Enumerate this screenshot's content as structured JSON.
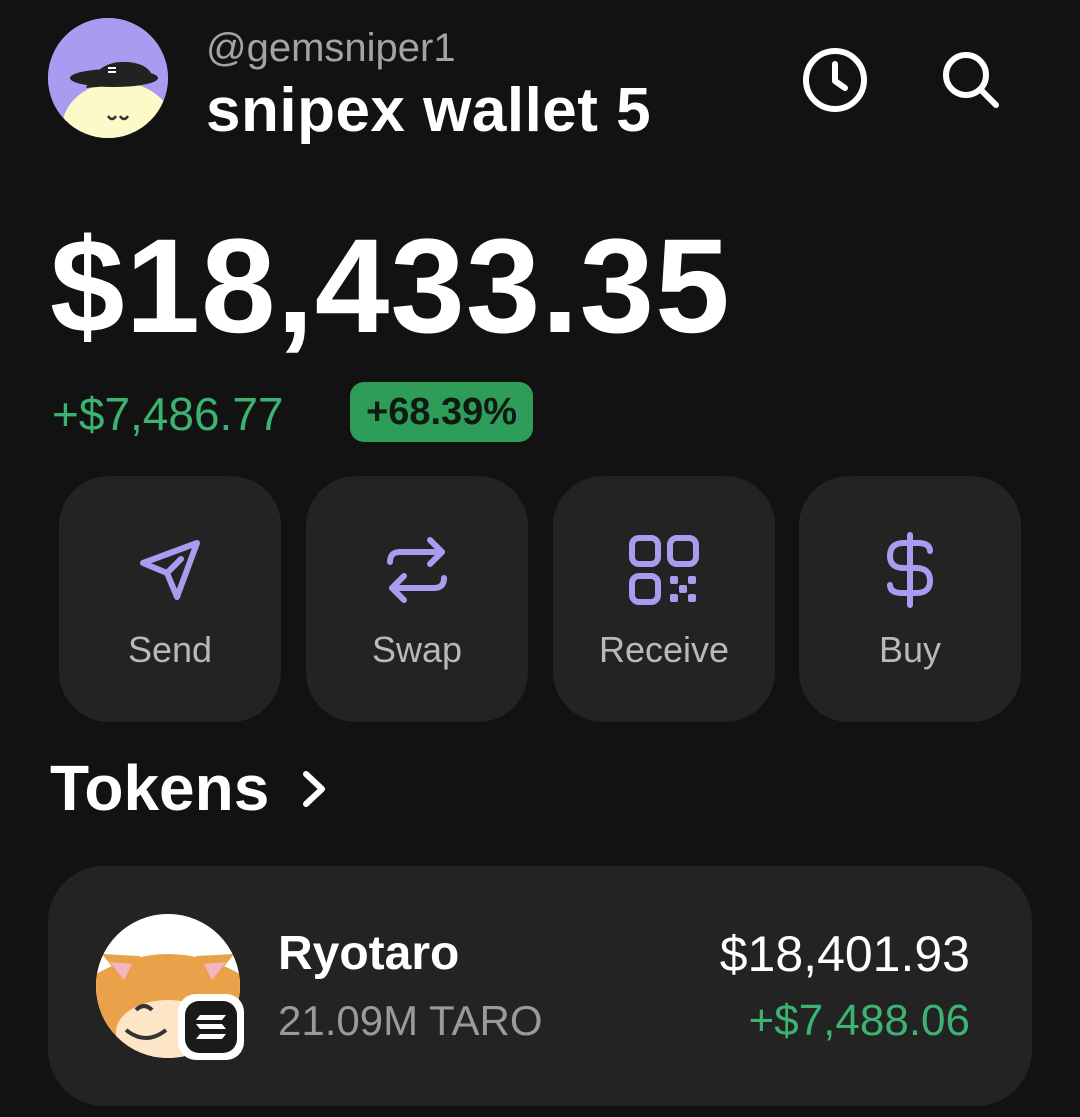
{
  "header": {
    "handle": "@gemsniper1",
    "wallet_name": "snipex wallet 5",
    "avatar_icon": "cartoon-avatar-icon",
    "history_icon": "clock-icon",
    "search_icon": "search-icon"
  },
  "balance": {
    "total": "$18,433.35",
    "change_amount": "+$7,486.77",
    "change_percent": "+68.39%"
  },
  "actions": [
    {
      "label": "Send",
      "icon": "send-icon"
    },
    {
      "label": "Swap",
      "icon": "swap-icon"
    },
    {
      "label": "Receive",
      "icon": "qr-code-icon"
    },
    {
      "label": "Buy",
      "icon": "dollar-icon"
    }
  ],
  "tokens": {
    "title": "Tokens",
    "items": [
      {
        "name": "Ryotaro",
        "quantity": "21.09M TARO",
        "value": "$18,401.93",
        "change": "+$7,488.06",
        "chain_icon": "solana-icon"
      }
    ]
  },
  "colors": {
    "background": "#121212",
    "card": "#232323",
    "accent_purple": "#a99cf0",
    "positive_green": "#3cb371",
    "pill_green": "#2e9d5a"
  }
}
